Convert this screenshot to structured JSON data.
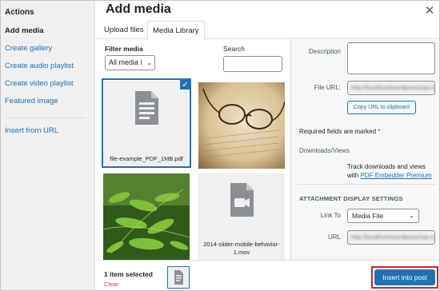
{
  "menu": {
    "title": "Actions",
    "items": [
      {
        "label": "Add media"
      },
      {
        "label": "Create gallery"
      },
      {
        "label": "Create audio playlist"
      },
      {
        "label": "Create video playlist"
      },
      {
        "label": "Featured image"
      },
      {
        "label": "Insert from URL"
      }
    ]
  },
  "frame": {
    "title": "Add media",
    "close_icon": "close-icon"
  },
  "tabs": [
    {
      "label": "Upload files"
    },
    {
      "label": "Media Library"
    }
  ],
  "filters": {
    "filter_label": "Filter media",
    "filter_value": "All media i",
    "search_label": "Search",
    "search_value": ""
  },
  "attachments": [
    {
      "filename": "file-example_PDF_1MB.pdf",
      "type": "document",
      "selected": true,
      "icon": "document-icon"
    },
    {
      "filename": "",
      "type": "image",
      "selected": false,
      "icon": "glasses-photo"
    },
    {
      "filename": "",
      "type": "image",
      "selected": false,
      "icon": "fern-photo"
    },
    {
      "filename": "2014-slider-mobile-behavior-1.mov",
      "type": "video",
      "selected": false,
      "icon": "video-icon"
    }
  ],
  "details": {
    "description_label": "Description",
    "file_url_label": "File URL:",
    "file_url_value": "http://localhost/wordpress/wp-content",
    "copy_button": "Copy URL to clipboard",
    "required_text": "Required fields are marked",
    "required_star": "*",
    "downloads_label": "Downloads/Views",
    "track_text": "Track downloads and views",
    "track_with": "with",
    "track_link": "PDF Embedder Premium"
  },
  "display_settings": {
    "heading": "ATTACHMENT DISPLAY SETTINGS",
    "link_to_label": "Link To",
    "link_to_value": "Media File",
    "url_label": "URL",
    "url_value": "http://localhost/wordpress/wp-content"
  },
  "toolbar": {
    "selection_count": "1 item selected",
    "clear_label": "Clear",
    "insert_button": "Insert into post"
  },
  "colors": {
    "accent": "#2271b1",
    "highlight": "#c9262c"
  }
}
